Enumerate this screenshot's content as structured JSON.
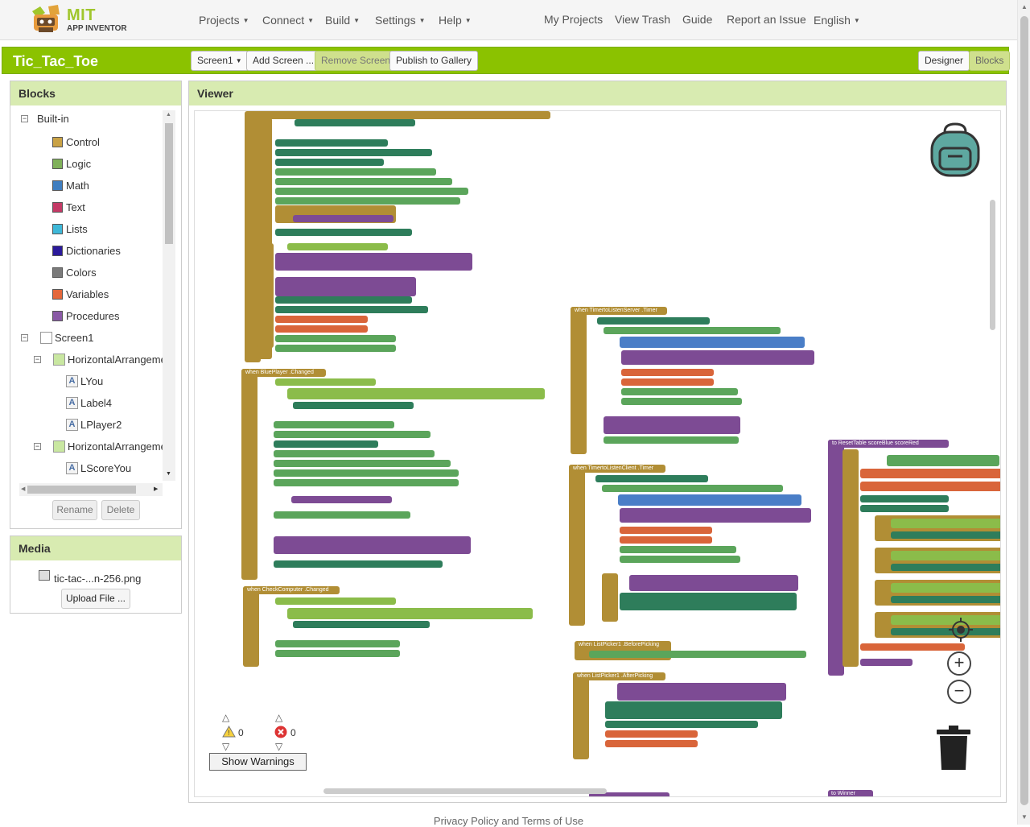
{
  "app": {
    "logo_text": "MIT",
    "logo_subtext": "APP INVENTOR"
  },
  "nav": {
    "projects": "Projects",
    "connect": "Connect",
    "build": "Build",
    "settings": "Settings",
    "help": "Help",
    "my_projects": "My Projects",
    "view_trash": "View Trash",
    "guide": "Guide",
    "report_issue": "Report an Issue",
    "language": "English"
  },
  "project": {
    "title": "Tic_Tac_Toe",
    "screen_select": "Screen1",
    "add_screen": "Add Screen ...",
    "remove_screen": "Remove Screen",
    "publish": "Publish to Gallery",
    "designer": "Designer",
    "blocks": "Blocks"
  },
  "blocks_panel": {
    "title": "Blocks",
    "builtin_label": "Built-in",
    "builtin": [
      {
        "label": "Control",
        "color": "#c9a245"
      },
      {
        "label": "Logic",
        "color": "#80b15a"
      },
      {
        "label": "Math",
        "color": "#3f7ec0"
      },
      {
        "label": "Text",
        "color": "#c43a66"
      },
      {
        "label": "Lists",
        "color": "#3eb8d8"
      },
      {
        "label": "Dictionaries",
        "color": "#2b1a9b"
      },
      {
        "label": "Colors",
        "color": "#7a7a7a"
      },
      {
        "label": "Variables",
        "color": "#e4673b"
      },
      {
        "label": "Procedures",
        "color": "#8a5aa6"
      }
    ],
    "components": [
      {
        "label": "Screen1",
        "level": 0,
        "toggle": "−"
      },
      {
        "label": "HorizontalArrangemen",
        "level": 1,
        "toggle": "−"
      },
      {
        "label": "LYou",
        "level": 2
      },
      {
        "label": "Label4",
        "level": 2
      },
      {
        "label": "LPlayer2",
        "level": 2
      },
      {
        "label": "HorizontalArrangemen",
        "level": 1,
        "toggle": "−"
      },
      {
        "label": "LScoreYou",
        "level": 2
      }
    ],
    "rename": "Rename",
    "delete": "Delete"
  },
  "media_panel": {
    "title": "Media",
    "file": "tic-tac-...n-256.png",
    "upload": "Upload File ..."
  },
  "viewer": {
    "title": "Viewer",
    "warnings_count": "0",
    "errors_count": "0",
    "show_warnings": "Show Warnings"
  },
  "blocks_workspace": {
    "event_timer_server": "when TimertoListenServer .Timer",
    "event_timer_client": "when TimertoListenClient .Timer",
    "event_blueplayer": "when BluePlayer .Changed",
    "event_checkcomputer": "when CheckComputer .Changed",
    "event_before_picking": "when ListPicker1 .BeforePicking",
    "event_after_picking": "when ListPicker1 .AfterPicking",
    "proc_reset": "to ResetTable scoreBlue scoreRed",
    "proc_winner": "to Winner"
  },
  "footer": {
    "text": "Privacy Policy and Terms of Use"
  }
}
